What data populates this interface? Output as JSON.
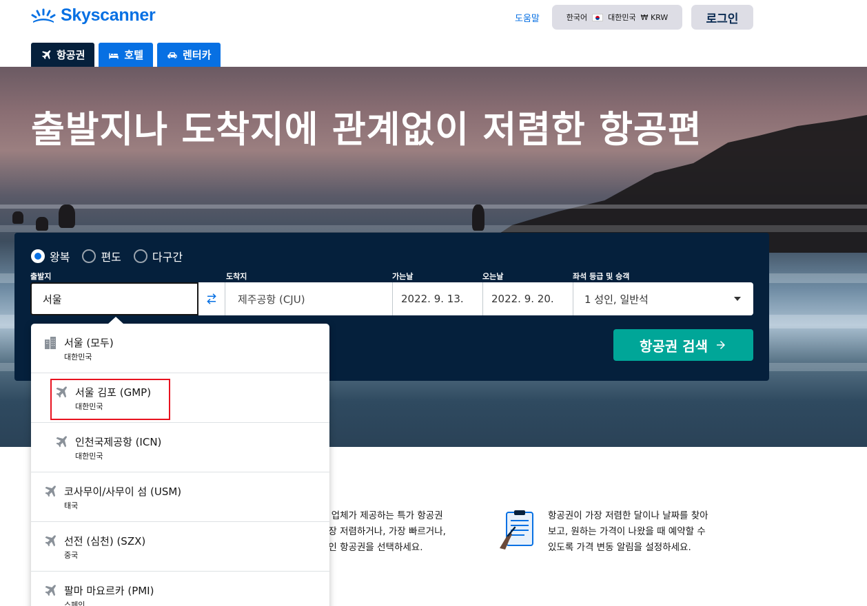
{
  "brand": {
    "name": "Skyscanner",
    "color": "#0770e3"
  },
  "header": {
    "help": "도움말",
    "language": "한국어",
    "country": "대한민국",
    "currency": "₩ KRW",
    "login": "로그인"
  },
  "tabs": [
    {
      "label": "항공권",
      "icon": "airplane-icon",
      "active": true
    },
    {
      "label": "호텔",
      "icon": "bed-icon",
      "active": false
    },
    {
      "label": "렌터카",
      "icon": "car-icon",
      "active": false
    }
  ],
  "hero": {
    "title": "출발지나 도착지에 관계없이 저렴한 항공편"
  },
  "search": {
    "trip_types": [
      {
        "label": "왕복",
        "checked": true
      },
      {
        "label": "편도",
        "checked": false
      },
      {
        "label": "다구간",
        "checked": false
      }
    ],
    "labels": {
      "from": "출발지",
      "to": "도착지",
      "depart": "가는날",
      "return": "오는날",
      "cabin": "좌석 등급 및 승객"
    },
    "values": {
      "from": "서울",
      "to": "제주공항 (CJU)",
      "depart": "2022. 9. 13.",
      "return": "2022. 9. 20.",
      "cabin": "1 성인, 일반석"
    },
    "button": "항공권 검색",
    "button_color": "#00a698"
  },
  "dropdown": {
    "items": [
      {
        "name": "서울 (모두)",
        "country": "대한민국",
        "type": "city",
        "icon": "city-icon"
      },
      {
        "name": "서울 김포 (GMP)",
        "country": "대한민국",
        "type": "airport-sub",
        "icon": "airplane-icon",
        "highlighted": true
      },
      {
        "name": "인천국제공항 (ICN)",
        "country": "대한민국",
        "type": "airport-sub",
        "icon": "airplane-icon"
      },
      {
        "name": "코사무이/사무이 섬 (USM)",
        "country": "태국",
        "type": "airport",
        "icon": "airplane-icon"
      },
      {
        "name": "선전 (심천) (SZX)",
        "country": "중국",
        "type": "airport",
        "icon": "airplane-icon"
      },
      {
        "name": "팔마 마요르카 (PMI)",
        "country": "스페인",
        "type": "airport",
        "icon": "airplane-icon"
      }
    ]
  },
  "info": {
    "left": [
      "의 업체가 제공하는 특가 항공권",
      "가장 저렴하거나, 가장 빠르거나,",
      "적인 항공권을 선택하세요."
    ],
    "right": [
      "항공권이 가장 저렴한 달이나 날짜를 찾아",
      "보고, 원하는 가격이 나왔을 때 예약할 수",
      "있도록 가격 변동 알림을 설정하세요."
    ]
  }
}
